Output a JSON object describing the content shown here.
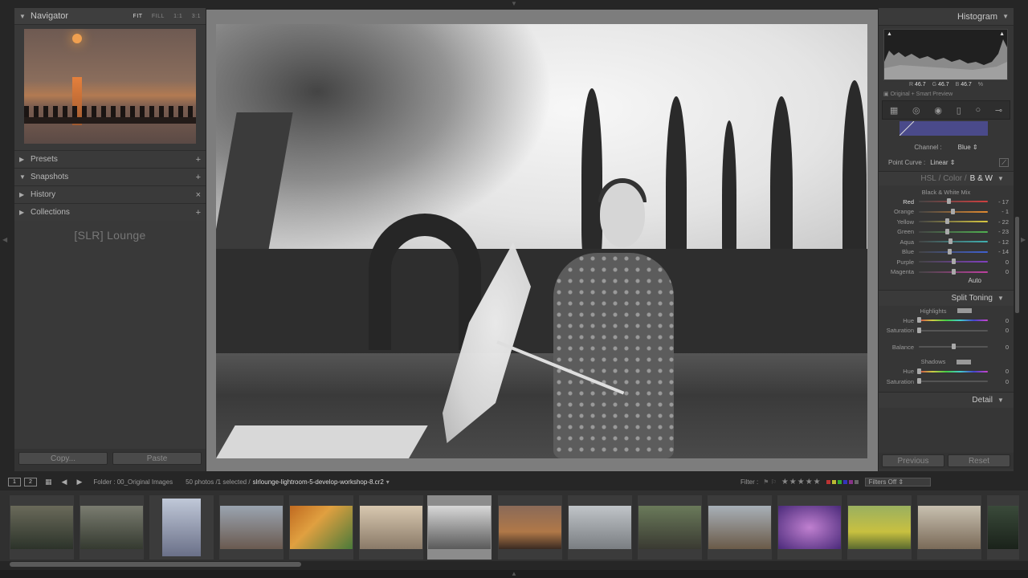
{
  "navigator": {
    "title": "Navigator",
    "zoom_opts": [
      "FIT",
      "FILL",
      "1:1",
      "3:1"
    ]
  },
  "left_sections": [
    {
      "label": "Presets",
      "action": "+"
    },
    {
      "label": "Snapshots",
      "action": "+"
    },
    {
      "label": "History",
      "action": "×"
    },
    {
      "label": "Collections",
      "action": "+"
    }
  ],
  "watermark": "[SLR] Lounge",
  "left_buttons": {
    "copy": "Copy...",
    "paste": "Paste"
  },
  "histogram": {
    "title": "Histogram",
    "r_label": "R",
    "r": "46.7",
    "g_label": "G",
    "g": "46.7",
    "b_label": "B",
    "b": "46.7",
    "pct": "%",
    "smart_preview": "Original + Smart Preview"
  },
  "tone_curve": {
    "channel_label": "Channel :",
    "channel": "Blue",
    "point_curve_label": "Point Curve :",
    "point_curve": "Linear"
  },
  "hsl": {
    "hsl": "HSL",
    "sep": "/",
    "color": "Color",
    "sep2": "/",
    "bw": "B & W",
    "mix_title": "Black & White Mix",
    "auto": "Auto"
  },
  "bw_mix": [
    {
      "name": "Red",
      "value": "- 17",
      "level": 0.43,
      "color": "#d04040"
    },
    {
      "name": "Orange",
      "value": "- 1",
      "level": 0.49,
      "color": "#e08a30"
    },
    {
      "name": "Yellow",
      "value": "- 22",
      "level": 0.41,
      "color": "#d8c840"
    },
    {
      "name": "Green",
      "value": "- 23",
      "level": 0.41,
      "color": "#50b050"
    },
    {
      "name": "Aqua",
      "value": "- 12",
      "level": 0.45,
      "color": "#40b0b0"
    },
    {
      "name": "Blue",
      "value": "- 14",
      "level": 0.44,
      "color": "#4060d0"
    },
    {
      "name": "Purple",
      "value": "0",
      "level": 0.5,
      "color": "#8040c0"
    },
    {
      "name": "Magenta",
      "value": "0",
      "level": 0.5,
      "color": "#c040a0"
    }
  ],
  "split_toning": {
    "title": "Split Toning",
    "highlights": "Highlights",
    "shadows": "Shadows",
    "hue": "Hue",
    "saturation": "Saturation",
    "balance": "Balance",
    "zero": "0"
  },
  "detail": {
    "title": "Detail"
  },
  "right_buttons": {
    "previous": "Previous",
    "reset": "Reset"
  },
  "filmstrip_bar": {
    "page1": "1",
    "page2": "2",
    "folder": "Folder : 00_Original Images",
    "count": "50 photos /1 selected /",
    "file": "slrlounge-lightroom-5-develop-workshop-8.cr2",
    "filter_label": "Filter :",
    "filters_off": "Filters Off",
    "stars": "★★★★★"
  },
  "colors": {
    "accent_selected": "#8c8c8c",
    "panel": "#393939",
    "background": "#262626"
  }
}
